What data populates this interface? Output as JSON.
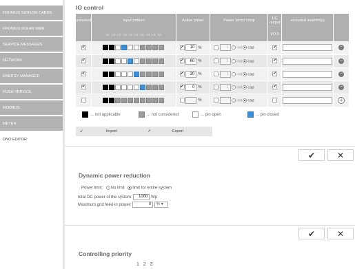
{
  "sidebar": {
    "items": [
      {
        "label": "FRONIUS SENSOR CARDS"
      },
      {
        "label": "FRONIUS SOLAR WEB"
      },
      {
        "label": "SERVICE MESSAGES"
      },
      {
        "label": "NETWORK"
      },
      {
        "label": "ENERGY MANAGER"
      },
      {
        "label": "PUSH SERVICE"
      },
      {
        "label": "MODBUS"
      },
      {
        "label": "METER"
      },
      {
        "label": "DNO EDITOR"
      }
    ]
  },
  "io_control": {
    "title": "IO control",
    "headers": {
      "unlocked": "unlocked",
      "input_pattern": "Input pattern",
      "active_power": "Active power",
      "power_factor": "Power factor cosφ",
      "uc_output": "UC output",
      "excluded": "excluded inverter(s)",
      "io_label": "I/O 0",
      "pin_labels": "IO IO IO IO IO IO IO IO IO IO"
    },
    "rows": [
      {
        "unlocked": true,
        "pattern": [
          "black",
          "black",
          "white",
          "blue",
          "white",
          "white",
          "gray",
          "gray",
          "gray",
          "gray"
        ],
        "active_checked": true,
        "power": "10",
        "pf_checked": false,
        "pf_value": "1",
        "ind_label": "ind",
        "cap_label": "cap",
        "uc": true,
        "excluded": ""
      },
      {
        "unlocked": true,
        "pattern": [
          "black",
          "black",
          "white",
          "white",
          "blue",
          "white",
          "gray",
          "gray",
          "gray",
          "gray"
        ],
        "active_checked": true,
        "power": "60",
        "pf_checked": false,
        "pf_value": "1",
        "ind_label": "ind",
        "cap_label": "cap",
        "uc": true,
        "excluded": ""
      },
      {
        "unlocked": true,
        "pattern": [
          "black",
          "black",
          "white",
          "white",
          "white",
          "blue",
          "gray",
          "gray",
          "gray",
          "gray"
        ],
        "active_checked": true,
        "power": "30",
        "pf_checked": false,
        "pf_value": "1",
        "ind_label": "ind",
        "cap_label": "cap",
        "uc": true,
        "excluded": ""
      },
      {
        "unlocked": true,
        "pattern": [
          "black",
          "black",
          "white",
          "white",
          "white",
          "white",
          "blue",
          "gray",
          "gray",
          "gray"
        ],
        "active_checked": true,
        "power": "0",
        "pf_checked": false,
        "pf_value": "1",
        "ind_label": "ind",
        "cap_label": "cap",
        "uc": true,
        "excluded": ""
      },
      {
        "unlocked": false,
        "pattern": [
          "black",
          "black",
          "gray",
          "gray",
          "gray",
          "gray",
          "gray",
          "gray",
          "gray",
          "gray"
        ],
        "active_checked": false,
        "power": "",
        "pf_checked": false,
        "pf_value": "",
        "ind_label": "ind",
        "cap_label": "cap",
        "uc": false,
        "excluded": ""
      }
    ],
    "pct": "%",
    "legend": {
      "not_applicable": "... not applicable",
      "not_considered": "... not considered",
      "pin_open": "... pin open",
      "pin_closed": "... pin closed"
    },
    "import_label": "Import",
    "export_label": "Export"
  },
  "actions": {
    "confirm": "✔",
    "cancel": "✕"
  },
  "dpr": {
    "title": "Dynamic power reduction",
    "power_limit_label": "Power limit:",
    "no_limit": "No limit",
    "limit_entire": "limit for entire system",
    "total_dc_label": "total DC power of the system:",
    "total_dc_value": "1000",
    "total_dc_unit": "Wp",
    "max_feed_label": "Maximum grid feed-in power:",
    "max_feed_value": "0",
    "max_feed_unit": "% ▾"
  },
  "priority": {
    "title": "Controlling priority",
    "pages": "1 2 3"
  },
  "colors": {
    "sidebar": "#b3b3b3",
    "header": "#b0b0b0",
    "blue": "#3d8fd6"
  }
}
